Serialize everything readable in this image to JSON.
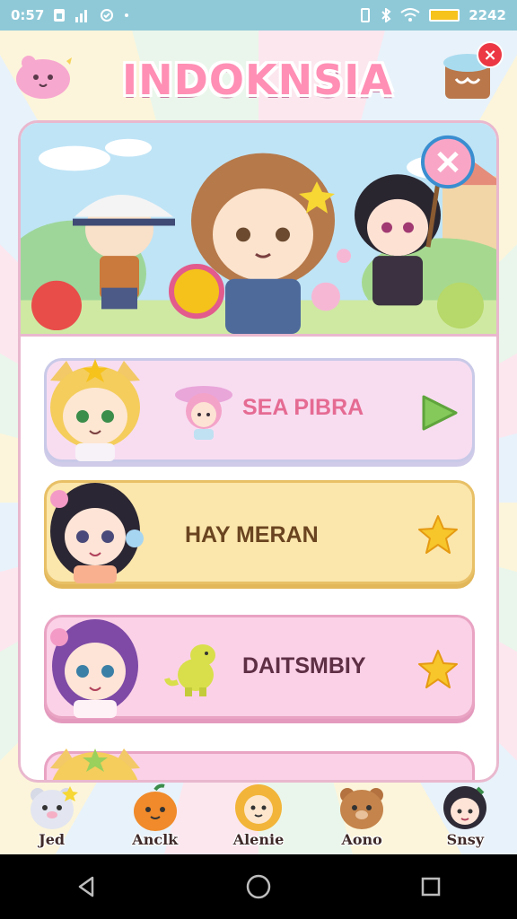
{
  "status_bar": {
    "time_left": "0:57",
    "icons_left": [
      "sim-icon",
      "signal-icon",
      "sync-icon",
      "dot-icon"
    ],
    "time_right": "2242",
    "icons_right": [
      "vibrate-icon",
      "bluetooth-icon",
      "wifi-icon",
      "battery-icon"
    ]
  },
  "header": {
    "title": "INDOKNSIA",
    "close_label": "×"
  },
  "list": {
    "items": [
      {
        "label": "SEA PIBRA",
        "action": "play-arrow-icon"
      },
      {
        "label": "HAY MERAN",
        "action": "star-icon"
      },
      {
        "label": "DAITSMBIY",
        "action": "star-icon"
      }
    ]
  },
  "tabs": [
    {
      "label": "Jed",
      "icon": "bear-cub-icon"
    },
    {
      "label": "Anclk",
      "icon": "orange-buddy-icon"
    },
    {
      "label": "Alenie",
      "icon": "lion-buddy-icon"
    },
    {
      "label": "Aono",
      "icon": "brown-bear-icon"
    },
    {
      "label": "Snsy",
      "icon": "dark-hair-girl-icon"
    }
  ],
  "colors": {
    "accent_pink": "#ff8fb4",
    "card_border": "#e9b8ce",
    "close_red": "#ec3844",
    "status_bar": "#8fc9d8"
  }
}
